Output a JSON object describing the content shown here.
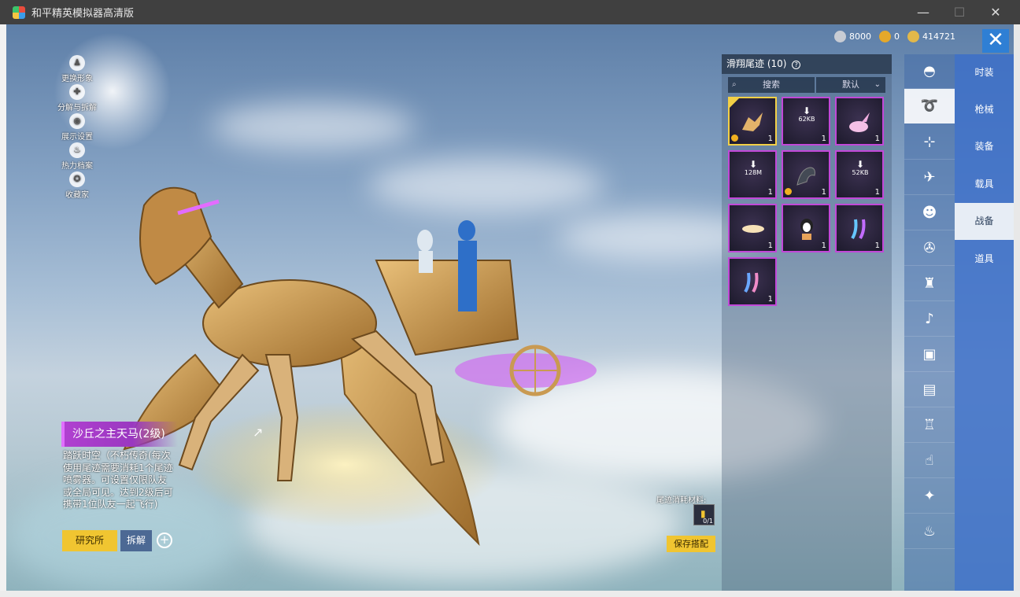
{
  "window": {
    "title": "和平精英模拟器高清版",
    "minimize": "—",
    "maximize": "☐",
    "close": "✕"
  },
  "currencies": [
    {
      "icon": "silver-coin-icon",
      "value": "8000",
      "color": "#c8ccd4"
    },
    {
      "icon": "gold-token-icon",
      "value": "0",
      "color": "#e5a82a"
    },
    {
      "icon": "diamond-coin-icon",
      "value": "414721",
      "color": "#e2b84a"
    }
  ],
  "close_game": "✕",
  "left_menu": [
    {
      "label": "更换形象",
      "icon": "person-icon",
      "glyph": "♟"
    },
    {
      "label": "分解与拆解",
      "icon": "gear-icon",
      "glyph": "✚"
    },
    {
      "label": "展示设置",
      "icon": "eye-icon",
      "glyph": "◉"
    },
    {
      "label": "热力档案",
      "icon": "flame-icon",
      "glyph": "♨"
    },
    {
      "label": "收藏家",
      "icon": "medal-icon",
      "glyph": "✪"
    }
  ],
  "item": {
    "name": "沙丘之主天马(2级)",
    "description": "踏跃时空（不朽传奇(每次使用尾迹需要消耗1个尾迹喷雾器。可设置仅限队友或全局可见。达到2级后可携带1位队友一起飞行)",
    "share_icon": "↗"
  },
  "buttons": {
    "research": "研究所",
    "dismantle": "拆解",
    "plus": "+",
    "save": "保存搭配"
  },
  "panel": {
    "title": "滑翔尾迹 (10)",
    "help": "?",
    "search_placeholder": "搜索",
    "sort": "默认"
  },
  "grid": [
    {
      "name": "pegasus",
      "qty": "1",
      "selected": true,
      "badge": true,
      "download": ""
    },
    {
      "name": "downloadable-1",
      "qty": "1",
      "selected": false,
      "badge": false,
      "download": "62KB"
    },
    {
      "name": "pink-flower",
      "qty": "1",
      "selected": false,
      "badge": false,
      "download": ""
    },
    {
      "name": "downloadable-2",
      "qty": "1",
      "selected": false,
      "badge": false,
      "download": "128M"
    },
    {
      "name": "dragon",
      "qty": "1",
      "selected": false,
      "badge": true,
      "download": ""
    },
    {
      "name": "downloadable-3",
      "qty": "1",
      "selected": false,
      "badge": false,
      "download": "52KB"
    },
    {
      "name": "meteor",
      "qty": "1",
      "selected": false,
      "badge": false,
      "download": ""
    },
    {
      "name": "penguin",
      "qty": "1",
      "selected": false,
      "badge": false,
      "download": ""
    },
    {
      "name": "rainbow-trail",
      "qty": "1",
      "selected": false,
      "badge": false,
      "download": ""
    },
    {
      "name": "blue-trail",
      "qty": "1",
      "selected": false,
      "badge": false,
      "download": ""
    }
  ],
  "categories": [
    {
      "icon": "helmet-icon",
      "glyph": "◓",
      "active": false
    },
    {
      "icon": "glider-trail-icon",
      "glyph": "➰",
      "active": true
    },
    {
      "icon": "drone-icon",
      "glyph": "⊹",
      "active": false
    },
    {
      "icon": "airplane-icon",
      "glyph": "✈",
      "active": false
    },
    {
      "icon": "emote-face-icon",
      "glyph": "☻",
      "active": false
    },
    {
      "icon": "parachute-plane-icon",
      "glyph": "✇",
      "active": false
    },
    {
      "icon": "backpack-icon",
      "glyph": "♜",
      "active": false
    },
    {
      "icon": "speaker-icon",
      "glyph": "♪",
      "active": false
    },
    {
      "icon": "pet-icon",
      "glyph": "▣",
      "active": false
    },
    {
      "icon": "photo-frame-icon",
      "glyph": "▤",
      "active": false
    },
    {
      "icon": "spray-icon",
      "glyph": "♖",
      "active": false
    },
    {
      "icon": "hand-tap-icon",
      "glyph": "☝",
      "active": false
    },
    {
      "icon": "wand-icon",
      "glyph": "✦",
      "active": false
    },
    {
      "icon": "chicken-icon",
      "glyph": "♨",
      "active": false
    }
  ],
  "tabs": [
    {
      "label": "时装",
      "active": false
    },
    {
      "label": "枪械",
      "active": false
    },
    {
      "label": "装备",
      "active": false
    },
    {
      "label": "载具",
      "active": false
    },
    {
      "label": "战备",
      "active": true
    },
    {
      "label": "道具",
      "active": false
    }
  ],
  "material": {
    "label": "尾迹消耗材料:",
    "value": "0/1"
  }
}
